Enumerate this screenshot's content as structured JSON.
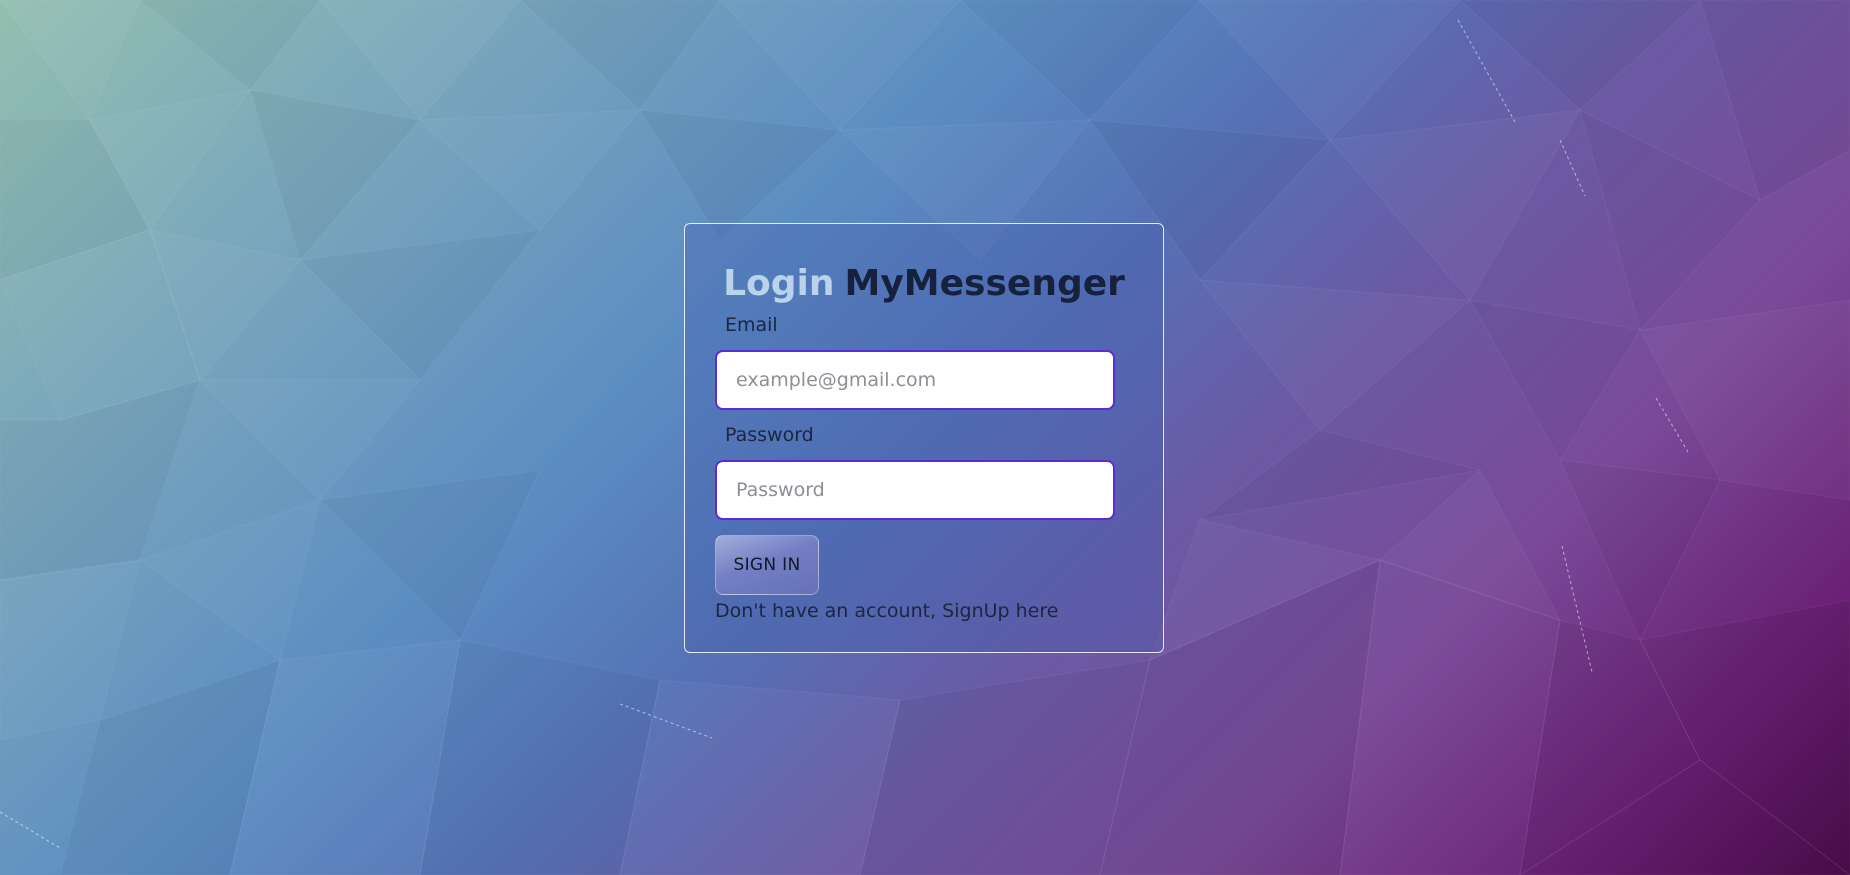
{
  "login": {
    "title_prefix": "Login",
    "title_brand": "MyMessenger",
    "email": {
      "label": "Email",
      "placeholder": "example@gmail.com",
      "value": ""
    },
    "password": {
      "label": "Password",
      "placeholder": "Password",
      "value": ""
    },
    "sign_in_label": "SIGN IN",
    "signup_text": "Don't have an account, SignUp here"
  },
  "colors": {
    "input_border": "#5b2bd8",
    "title_prefix": "#b9d3ea",
    "title_brand": "#16213e",
    "text": "#1b2640"
  }
}
